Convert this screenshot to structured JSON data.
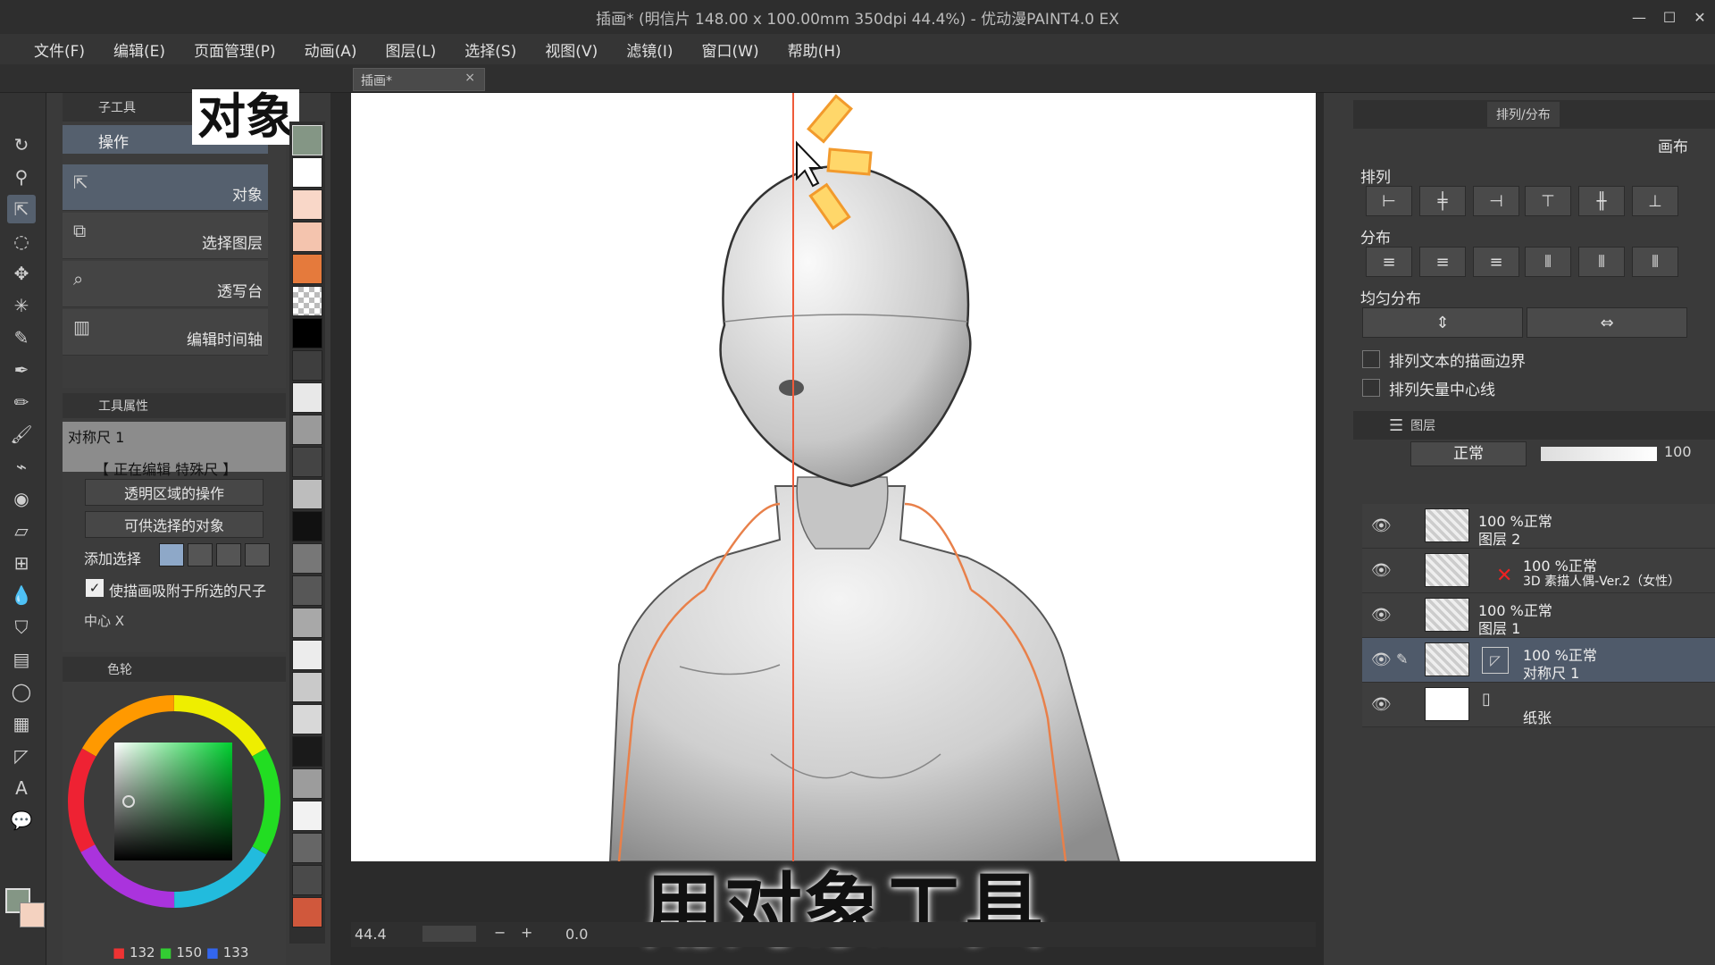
{
  "window": {
    "title": "插画* (明信片 148.00 x 100.00mm 350dpi 44.4%) - 优动漫PAINT4.0 EX"
  },
  "menu": [
    "文件(F)",
    "编辑(E)",
    "页面管理(P)",
    "动画(A)",
    "图层(L)",
    "选择(S)",
    "视图(V)",
    "滤镜(I)",
    "窗口(W)",
    "帮助(H)"
  ],
  "document_tab": {
    "label": "插画*",
    "close": "×"
  },
  "overlay": {
    "title": "对象",
    "subtitle": "用对象工具"
  },
  "subtool": {
    "header": "子工具",
    "group": "操作",
    "items": [
      {
        "label": "对象",
        "icon": "object-select-icon"
      },
      {
        "label": "选择图层",
        "icon": "select-layer-icon"
      },
      {
        "label": "透写台",
        "icon": "light-table-icon"
      },
      {
        "label": "编辑时间轴",
        "icon": "timeline-icon"
      }
    ]
  },
  "tool_property": {
    "header": "工具属性",
    "ruler_name": "对称尺 1",
    "editing": "【 正在编辑 特殊尺 】",
    "transparent_op": "透明区域的操作",
    "selectable": "可供选择的对象",
    "add_select": "添加选择",
    "snap_label": "使描画吸附于所选的尺子",
    "center_x": "中心 X"
  },
  "color": {
    "header": "色轮",
    "r": "132",
    "g": "150",
    "b": "133",
    "main_color": "#849685",
    "sub_color": "#f4d2c0"
  },
  "status": {
    "zoom": "44.4",
    "angle": "0.0"
  },
  "right": {
    "tab_align": "排列/分布",
    "canvas_label": "画布",
    "align_label": "排列",
    "distribute_label": "分布",
    "even_label": "均匀分布",
    "check1": "排列文本的描画边界",
    "check2": "排列矢量中心线",
    "layer_tab": "图层",
    "blend": "正常",
    "opacity": "100"
  },
  "layers": [
    {
      "line1": "100 %正常",
      "line2": "图层 2",
      "selected": false
    },
    {
      "line1": "100 %正常",
      "line2": "3D 素描人偶-Ver.2（女性）",
      "selected": false
    },
    {
      "line1": "100 %正常",
      "line2": "图层 1",
      "selected": false
    },
    {
      "line1": "100 %正常",
      "line2": "对称尺 1",
      "selected": true
    },
    {
      "line1": "",
      "line2": "纸张",
      "selected": false
    }
  ]
}
